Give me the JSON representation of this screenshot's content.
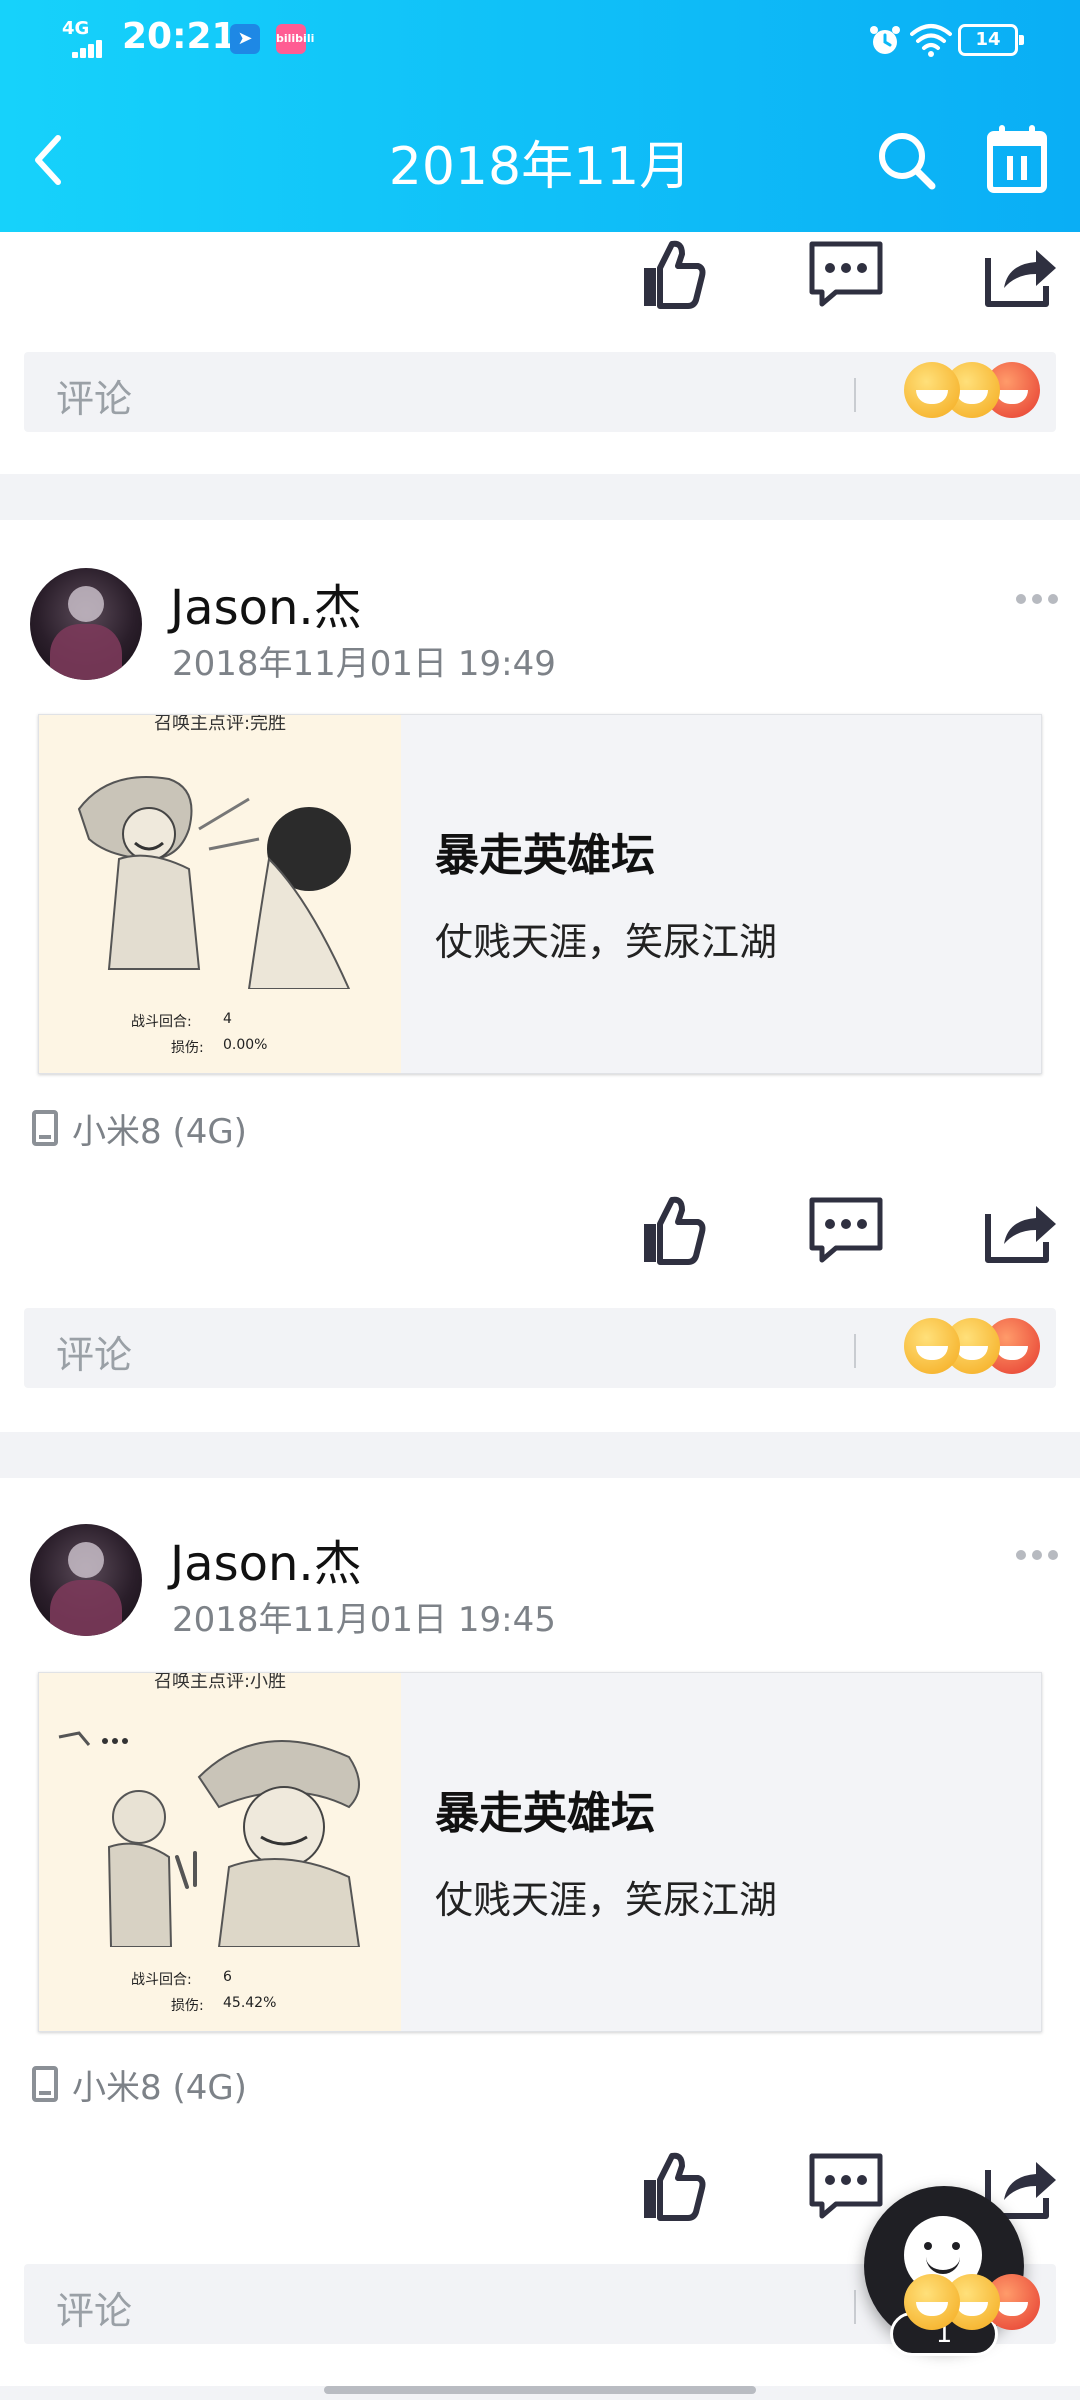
{
  "status_bar": {
    "network": "4G",
    "time": "20:21",
    "app_icon_2_text": "bilibili",
    "battery": "14"
  },
  "nav": {
    "title": "2018年11月"
  },
  "comment_placeholder": "评论",
  "posts": [
    {
      "author": "Jason.杰",
      "timestamp": "2018年11月01日 19:49",
      "card": {
        "image_caption": "召唤主点评:完胜",
        "stat_round_label": "战斗回合:",
        "stat_round_value": "4",
        "stat_damage_label": "损伤:",
        "stat_damage_value": "0.00%",
        "title": "暴走英雄坛",
        "description": "仗贱天涯，笑尿江湖"
      },
      "device": "小米8 (4G)"
    },
    {
      "author": "Jason.杰",
      "timestamp": "2018年11月01日 19:45",
      "card": {
        "image_caption": "召唤主点评:小胜",
        "stat_round_label": "战斗回合:",
        "stat_round_value": "6",
        "stat_damage_label": "损伤:",
        "stat_damage_value": "45.42%",
        "title": "暴走英雄坛",
        "description": "仗贱天涯，笑尿江湖"
      },
      "device": "小米8 (4G)"
    }
  ],
  "fab": {
    "badge": "1"
  },
  "colors": {
    "header_start": "#16d2fb",
    "header_end": "#0aaef5",
    "divider": "#f2f3f6",
    "icon_dark": "#2f3040"
  },
  "icons": [
    "back-arrow-icon",
    "search-icon",
    "calendar-icon",
    "like-icon",
    "comment-icon",
    "share-icon",
    "more-icon",
    "phone-icon"
  ]
}
